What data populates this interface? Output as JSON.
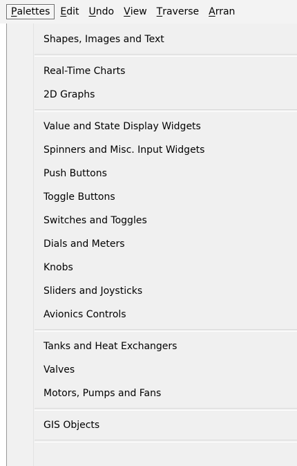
{
  "menubar": {
    "items": [
      {
        "mnemonic": "P",
        "rest": "alettes"
      },
      {
        "mnemonic": "E",
        "rest": "dit"
      },
      {
        "mnemonic": "U",
        "rest": "ndo"
      },
      {
        "mnemonic": "V",
        "rest": "iew"
      },
      {
        "mnemonic": "T",
        "rest": "raverse"
      },
      {
        "mnemonic": "A",
        "rest": "rran"
      }
    ]
  },
  "palettes_menu": {
    "groups": [
      [
        "Shapes, Images and Text"
      ],
      [
        "Real-Time Charts",
        "2D Graphs"
      ],
      [
        "Value and State Display Widgets",
        "Spinners and Misc. Input Widgets",
        "Push Buttons",
        "Toggle Buttons",
        "Switches and Toggles",
        "Dials and Meters",
        "Knobs",
        "Sliders and Joysticks",
        "Avionics Controls"
      ],
      [
        "Tanks and Heat Exchangers",
        "Valves",
        "Motors, Pumps and Fans"
      ],
      [
        "GIS Objects"
      ]
    ]
  }
}
